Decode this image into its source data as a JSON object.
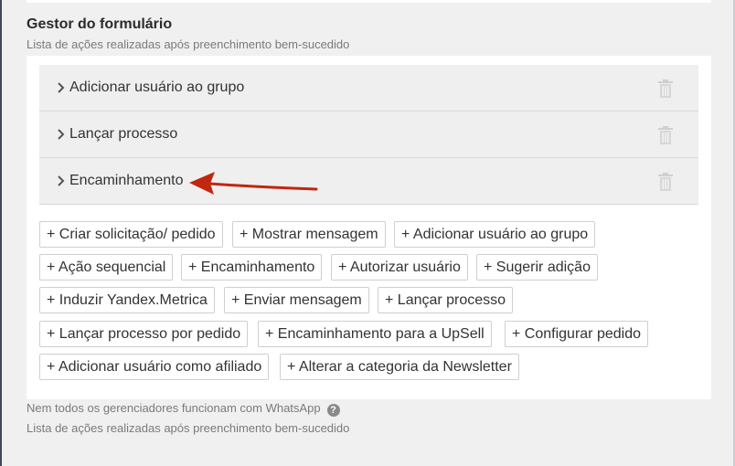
{
  "form_manager": {
    "title": "Gestor do formulário",
    "subtitle": "Lista de ações realizadas após preenchimento bem-sucedido",
    "actions": [
      {
        "label": "Adicionar usuário ao grupo",
        "icon": "chevron-right-icon",
        "delete_icon": "trash-icon"
      },
      {
        "label": "Lançar processo",
        "icon": "chevron-right-icon",
        "delete_icon": "trash-icon"
      },
      {
        "label": "Encaminhamento",
        "icon": "chevron-right-icon",
        "delete_icon": "trash-icon"
      }
    ],
    "add_buttons": [
      [
        "+ Criar solicitação/ pedido",
        "+ Mostrar mensagem",
        "+ Adicionar usuário ao grupo"
      ],
      [
        "+ Ação sequencial",
        "+ Encaminhamento",
        "+ Autorizar usuário",
        "+ Sugerir adição"
      ],
      [
        "+ Induzir Yandex.Metrica",
        "+ Enviar mensagem",
        "+ Lançar processo"
      ],
      [
        "+ Lançar processo por pedido",
        "+ Encaminhamento para a UpSell",
        "+ Configurar pedido"
      ],
      [
        "+ Adicionar usuário como afiliado",
        "+ Alterar a categoria da Newsletter"
      ]
    ],
    "note": "Nem todos os gerenciadores funcionam com WhatsApp",
    "note_help_icon": "question-circle-icon",
    "note_help_glyph": "?",
    "footer_subtitle": "Lista de ações realizadas após preenchimento bem-sucedido"
  },
  "annotation": {
    "icon": "red-arrow-icon",
    "color": "#c0270f"
  },
  "colors": {
    "panel": "#ffffff",
    "row_bg": "#efefef",
    "page_bg": "#f0f0f1",
    "left_border": "#3d4b5c"
  }
}
